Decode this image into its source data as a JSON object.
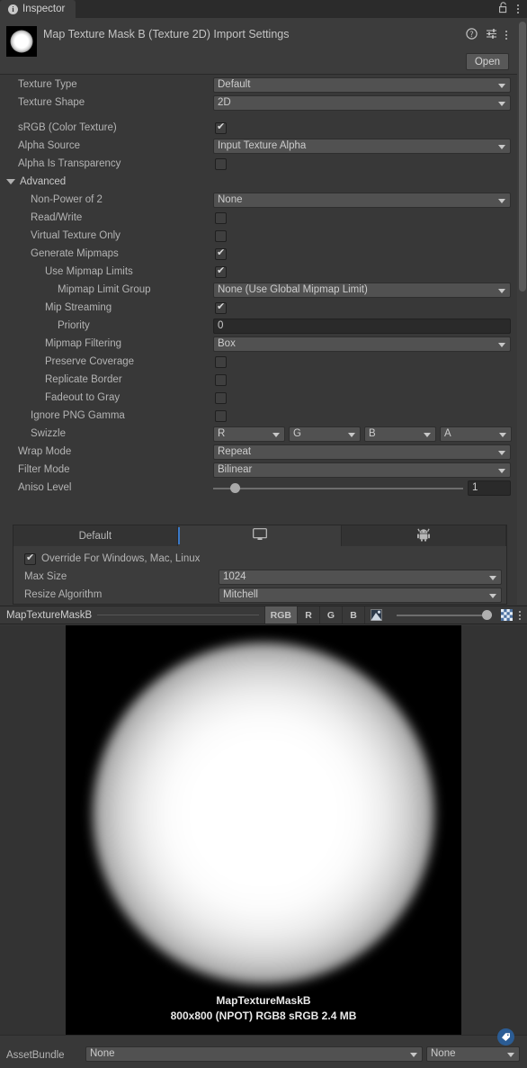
{
  "window": {
    "tab_label": "Inspector",
    "info_icon": "info-icon",
    "lock_icon": "lock-icon",
    "menu_icon": "kebab-menu-icon"
  },
  "header": {
    "title": "Map Texture Mask B (Texture 2D) Import Settings",
    "help_icon": "help-icon",
    "preset_icon": "preset-settings-icon",
    "menu_icon": "kebab-menu-icon",
    "open_label": "Open"
  },
  "properties": [
    {
      "label": "Texture Type",
      "indent": 0,
      "type": "dropdown",
      "value": "Default"
    },
    {
      "label": "Texture Shape",
      "indent": 0,
      "type": "dropdown",
      "value": "2D"
    },
    {
      "label": "",
      "indent": 0,
      "type": "gap",
      "value": ""
    },
    {
      "label": "sRGB (Color Texture)",
      "indent": 0,
      "type": "checkbox",
      "value": true
    },
    {
      "label": "Alpha Source",
      "indent": 0,
      "type": "dropdown",
      "value": "Input Texture Alpha"
    },
    {
      "label": "Alpha Is Transparency",
      "indent": 0,
      "type": "checkbox",
      "value": false
    },
    {
      "label": "Advanced",
      "indent": 0,
      "type": "foldout",
      "value": "expanded"
    },
    {
      "label": "Non-Power of 2",
      "indent": 1,
      "type": "dropdown",
      "value": "None"
    },
    {
      "label": "Read/Write",
      "indent": 1,
      "type": "checkbox",
      "value": false
    },
    {
      "label": "Virtual Texture Only",
      "indent": 1,
      "type": "checkbox",
      "value": false
    },
    {
      "label": "Generate Mipmaps",
      "indent": 1,
      "type": "checkbox",
      "value": true
    },
    {
      "label": "Use Mipmap Limits",
      "indent": 2,
      "type": "checkbox",
      "value": true
    },
    {
      "label": "Mipmap Limit Group",
      "indent": 3,
      "type": "dropdown",
      "value": "None (Use Global Mipmap Limit)"
    },
    {
      "label": "Mip Streaming",
      "indent": 2,
      "type": "checkbox",
      "value": true
    },
    {
      "label": "Priority",
      "indent": 3,
      "type": "text",
      "value": "0"
    },
    {
      "label": "Mipmap Filtering",
      "indent": 2,
      "type": "dropdown",
      "value": "Box"
    },
    {
      "label": "Preserve Coverage",
      "indent": 2,
      "type": "checkbox",
      "value": false
    },
    {
      "label": "Replicate Border",
      "indent": 2,
      "type": "checkbox",
      "value": false
    },
    {
      "label": "Fadeout to Gray",
      "indent": 2,
      "type": "checkbox",
      "value": false
    },
    {
      "label": "Ignore PNG Gamma",
      "indent": 1,
      "type": "checkbox",
      "value": false
    },
    {
      "label": "Swizzle",
      "indent": 1,
      "type": "swizzle",
      "value": [
        "R",
        "G",
        "B",
        "A"
      ]
    },
    {
      "label": "Wrap Mode",
      "indent": 0,
      "type": "dropdown",
      "value": "Repeat"
    },
    {
      "label": "Filter Mode",
      "indent": 0,
      "type": "dropdown",
      "value": "Bilinear"
    },
    {
      "label": "Aniso Level",
      "indent": 0,
      "type": "slider",
      "value": "1"
    }
  ],
  "platform": {
    "tabs": [
      {
        "label": "Default",
        "icon": "",
        "selected": false
      },
      {
        "label": "",
        "icon": "standalone-monitor-icon",
        "selected": true
      },
      {
        "label": "",
        "icon": "android-robot-icon",
        "selected": false
      }
    ],
    "override_label": "Override For Windows, Mac, Linux",
    "override_checked": true,
    "rows": [
      {
        "label": "Max Size",
        "value": "1024"
      },
      {
        "label": "Resize Algorithm",
        "value": "Mitchell"
      }
    ]
  },
  "preview_toolbar": {
    "name": "MapTextureMaskB",
    "channel_buttons": [
      {
        "label": "RGB",
        "active": true
      },
      {
        "label": "R",
        "active": false
      },
      {
        "label": "G",
        "active": false
      },
      {
        "label": "B",
        "active": false
      }
    ],
    "mip_icon": "mipmap-icon",
    "alpha_icon": "checkerboard-alpha-icon",
    "menu_icon": "kebab-menu-icon"
  },
  "preview": {
    "caption_name": "MapTextureMaskB",
    "caption_info": "800x800 (NPOT)  RGB8 sRGB   2.4 MB"
  },
  "bottom": {
    "tag_icon": "asset-label-tag-icon",
    "assetbundle_label": "AssetBundle",
    "bundle_name": "None",
    "bundle_variant": "None"
  },
  "colors": {
    "window_bg": "#383838",
    "panel_bg": "#3c3c3c",
    "tabbar_bg": "#2b2b2b",
    "accent_blue": "#3a79c8",
    "badge_blue": "#2b5c94"
  }
}
